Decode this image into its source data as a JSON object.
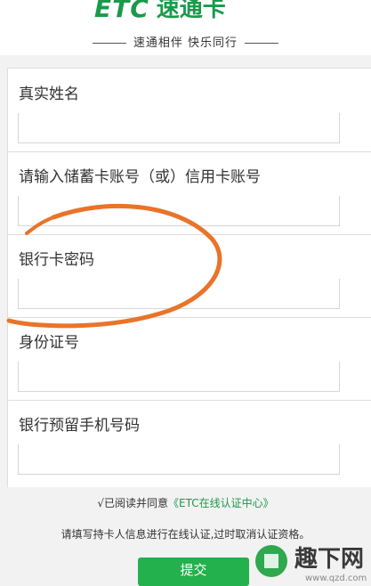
{
  "header": {
    "logo_mark": "ETC",
    "logo_text": "速通卡",
    "slogan": "速通相伴 快乐同行"
  },
  "form": {
    "fields": [
      {
        "label": "真实姓名",
        "value": ""
      },
      {
        "label": "请输入储蓄卡账号（或）信用卡账号",
        "value": ""
      },
      {
        "label": "银行卡密码",
        "value": ""
      },
      {
        "label": "身份证号",
        "value": ""
      },
      {
        "label": "银行预留手机号码",
        "value": ""
      }
    ]
  },
  "agreement": {
    "prefix": "√已阅读并同意",
    "link": "《ETC在线认证中心》"
  },
  "notice": "请填写持卡人信息进行在线认证,过时取消认证资格。",
  "submit_label": "提交",
  "watermark": {
    "text": "趣下网",
    "url": "www.qzd.com"
  },
  "colors": {
    "brand_green": "#1a9a4a",
    "button_green": "#22b14c",
    "annotation_orange": "#e8742a"
  }
}
